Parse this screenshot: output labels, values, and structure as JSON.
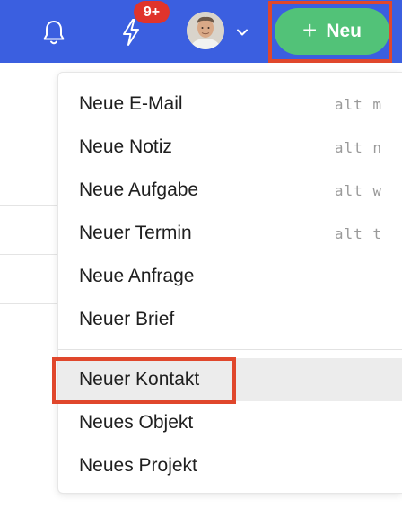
{
  "topbar": {
    "bg_color": "#3b5fe0",
    "notifications_badge": "9+",
    "new_button": {
      "label": "Neu",
      "plus": "+",
      "color": "#52c278"
    }
  },
  "menu": {
    "items": [
      {
        "label": "Neue E-Mail",
        "shortcut": "alt m"
      },
      {
        "label": "Neue Notiz",
        "shortcut": "alt n"
      },
      {
        "label": "Neue Aufgabe",
        "shortcut": "alt w"
      },
      {
        "label": "Neuer Termin",
        "shortcut": "alt t"
      },
      {
        "label": "Neue Anfrage",
        "shortcut": ""
      },
      {
        "label": "Neuer Brief",
        "shortcut": ""
      },
      {
        "label": "Neuer Kontakt",
        "shortcut": ""
      },
      {
        "label": "Neues Objekt",
        "shortcut": ""
      },
      {
        "label": "Neues Projekt",
        "shortcut": ""
      }
    ]
  },
  "highlight_color": "#e0472c"
}
